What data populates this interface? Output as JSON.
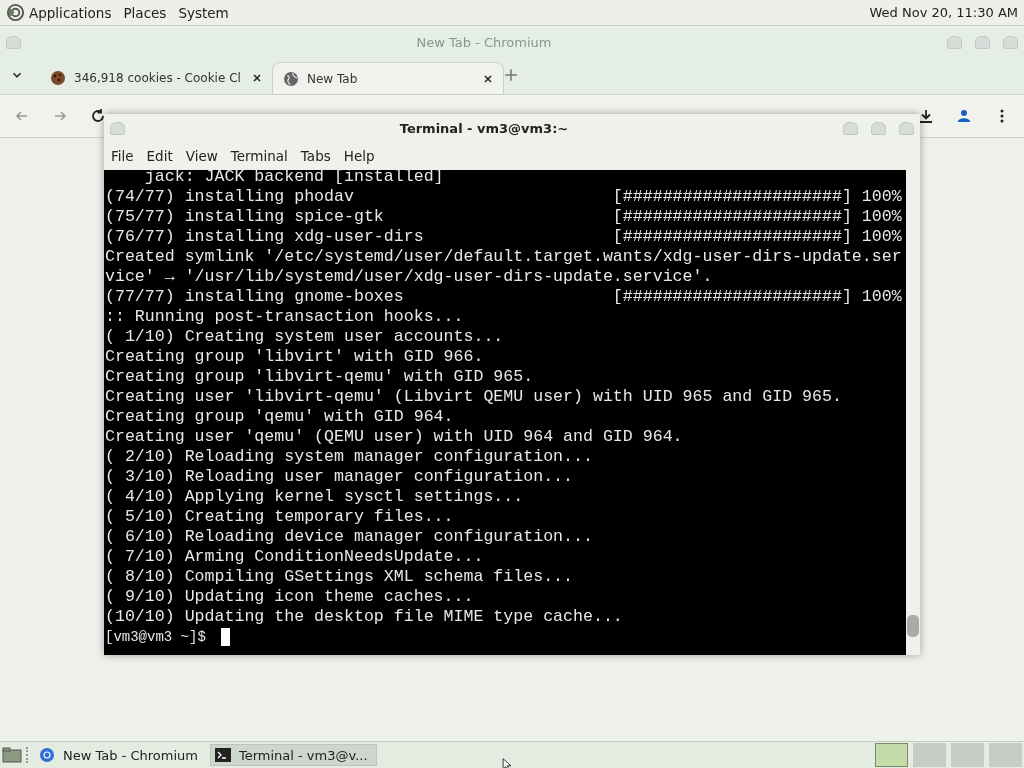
{
  "top_panel": {
    "menus": [
      "Applications",
      "Places",
      "System"
    ],
    "clock": "Wed Nov 20, 11:30 AM"
  },
  "browser": {
    "title": "New Tab - Chromium",
    "tabs": [
      {
        "label": "346,918 cookies - Cookie Cl",
        "selected": false,
        "kind": "cookie"
      },
      {
        "label": "New Tab",
        "selected": true,
        "kind": "globe"
      }
    ]
  },
  "terminal": {
    "title": "Terminal - vm3@vm3:~",
    "menus": [
      "File",
      "Edit",
      "View",
      "Terminal",
      "Tabs",
      "Help"
    ],
    "lines": [
      "    jack: JACK backend [installed]",
      "(74/77) installing phodav                          [######################] 100%",
      "(75/77) installing spice-gtk                       [######################] 100%",
      "(76/77) installing xdg-user-dirs                   [######################] 100%",
      "Created symlink '/etc/systemd/user/default.target.wants/xdg-user-dirs-update.ser",
      "vice' → '/usr/lib/systemd/user/xdg-user-dirs-update.service'.",
      "(77/77) installing gnome-boxes                     [######################] 100%",
      ":: Running post-transaction hooks...",
      "( 1/10) Creating system user accounts...",
      "Creating group 'libvirt' with GID 966.",
      "Creating group 'libvirt-qemu' with GID 965.",
      "Creating user 'libvirt-qemu' (Libvirt QEMU user) with UID 965 and GID 965.",
      "Creating group 'qemu' with GID 964.",
      "Creating user 'qemu' (QEMU user) with UID 964 and GID 964.",
      "( 2/10) Reloading system manager configuration...",
      "( 3/10) Reloading user manager configuration...",
      "( 4/10) Applying kernel sysctl settings...",
      "( 5/10) Creating temporary files...",
      "( 6/10) Reloading device manager configuration...",
      "( 7/10) Arming ConditionNeedsUpdate...",
      "( 8/10) Compiling GSettings XML schema files...",
      "( 9/10) Updating icon theme caches...",
      "(10/10) Updating the desktop file MIME type cache..."
    ],
    "prompt": "[vm3@vm3 ~]$"
  },
  "taskbar": {
    "items": [
      {
        "label": "New Tab - Chromium",
        "selected": false,
        "kind": "chromium"
      },
      {
        "label": "Terminal - vm3@v...",
        "selected": true,
        "kind": "terminal"
      }
    ],
    "workspaces": [
      {
        "selected": true
      },
      {
        "selected": false
      },
      {
        "selected": false
      },
      {
        "selected": false
      }
    ]
  }
}
